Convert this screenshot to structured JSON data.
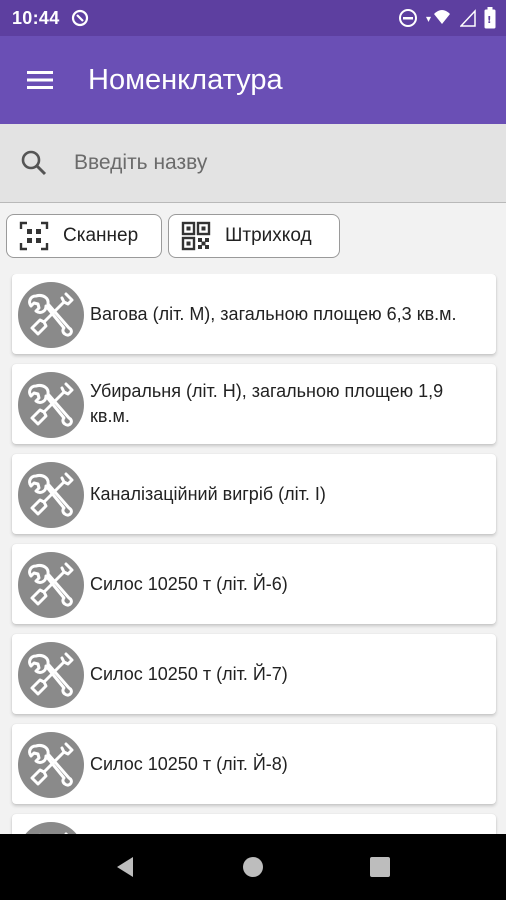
{
  "status": {
    "time": "10:44"
  },
  "appbar": {
    "title": "Номенклатура"
  },
  "search": {
    "placeholder": "Введіть назву"
  },
  "buttons": {
    "scanner": "Сканнер",
    "barcode": "Штрихкод"
  },
  "items": [
    {
      "title": "Вагова (літ. М), загальною площею 6,3 кв.м."
    },
    {
      "title": "Убиральня (літ. Н), загальною площею 1,9 кв.м."
    },
    {
      "title": "Каналізаційний вигріб (літ. І)"
    },
    {
      "title": "Силос 10250 т (літ. Й-6)"
    },
    {
      "title": "Силос 10250 т (літ. Й-7)"
    },
    {
      "title": "Силос 10250 т (літ. Й-8)"
    }
  ],
  "colors": {
    "statusbar": "#5d3fa0",
    "appbar": "#6a4fb5",
    "avatar": "#8a8a8a"
  },
  "icons": [
    "menu-icon",
    "search-icon",
    "qr-scan-icon",
    "qr-code-icon",
    "tools-icon"
  ]
}
